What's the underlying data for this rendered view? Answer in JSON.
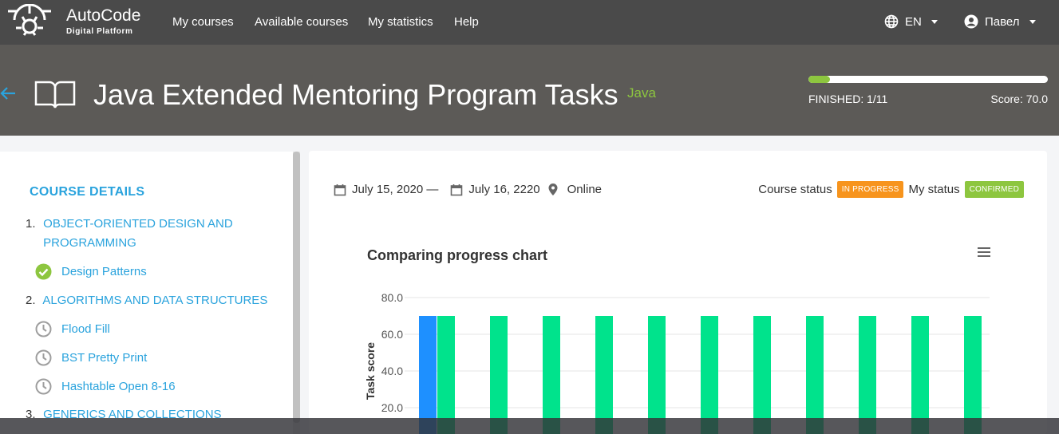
{
  "nav": {
    "brand": "AutoCode",
    "brand_sub": "Digital Platform",
    "items": [
      "My courses",
      "Available courses",
      "My statistics",
      "Help"
    ],
    "lang": "EN",
    "user": "Павел"
  },
  "course": {
    "title": "Java Extended Mentoring Program Tasks",
    "tag": "Java",
    "progress_fraction": 0.09,
    "finished": "FINISHED: 1/11",
    "score": "Score: 70.0"
  },
  "sidebar": {
    "heading": "COURSE DETAILS",
    "sections": [
      {
        "num": "1.",
        "line1": "OBJECT-ORIENTED DESIGN AND",
        "line2": "PROGRAMMING"
      },
      {
        "num": "2.",
        "line1": "ALGORITHMS AND DATA STRUCTURES"
      },
      {
        "num": "3.",
        "line1": "GENERICS AND COLLECTIONS"
      }
    ],
    "tasks": [
      {
        "label": "Design Patterns",
        "icon": "check-circle-icon"
      },
      {
        "label": "Flood Fill",
        "icon": "clock-icon"
      },
      {
        "label": "BST Pretty Print",
        "icon": "clock-icon"
      },
      {
        "label": "Hashtable Open 8-16",
        "icon": "clock-icon"
      }
    ]
  },
  "main": {
    "start_date": "July 15, 2020 —",
    "end_date": "July 16, 2220",
    "location": "Online",
    "course_status_label": "Course status",
    "course_status": "IN PROGRESS",
    "my_status_label": "My status",
    "my_status": "CONFIRMED",
    "colors": {
      "in_progress": "#f7941d",
      "confirmed": "#8dc63f"
    }
  },
  "chart_data": {
    "type": "bar",
    "title": "Comparing progress chart",
    "ylabel": "Task score",
    "ylim": [
      0,
      80
    ],
    "yticks": [
      "80.0",
      "60.0",
      "40.0",
      "20.0"
    ],
    "series": [
      {
        "values": [
          70
        ],
        "color": "#1e90ff"
      },
      {
        "values": [
          70,
          70,
          70,
          70,
          70,
          70,
          70,
          70,
          70,
          70,
          70
        ],
        "color": "#00e38c"
      }
    ]
  }
}
